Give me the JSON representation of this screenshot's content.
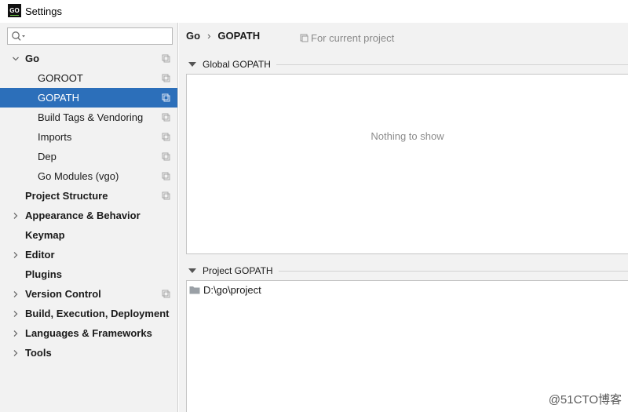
{
  "window": {
    "title": "Settings",
    "app_icon_text": "GO"
  },
  "search": {
    "value": "",
    "placeholder": ""
  },
  "sidebar": {
    "items": [
      {
        "label": "Go",
        "bold": true,
        "expanded": true,
        "has_arrow": true,
        "level": 0,
        "project_icon": true
      },
      {
        "label": "GOROOT",
        "bold": false,
        "has_arrow": false,
        "level": 1,
        "project_icon": true
      },
      {
        "label": "GOPATH",
        "bold": false,
        "has_arrow": false,
        "level": 1,
        "project_icon": true,
        "selected": true
      },
      {
        "label": "Build Tags & Vendoring",
        "bold": false,
        "has_arrow": false,
        "level": 1,
        "project_icon": true
      },
      {
        "label": "Imports",
        "bold": false,
        "has_arrow": false,
        "level": 1,
        "project_icon": true
      },
      {
        "label": "Dep",
        "bold": false,
        "has_arrow": false,
        "level": 1,
        "project_icon": true
      },
      {
        "label": "Go Modules (vgo)",
        "bold": false,
        "has_arrow": false,
        "level": 1,
        "project_icon": true
      },
      {
        "label": "Project Structure",
        "bold": true,
        "has_arrow": false,
        "level": 0,
        "project_icon": true
      },
      {
        "label": "Appearance & Behavior",
        "bold": true,
        "expanded": false,
        "has_arrow": true,
        "level": 0,
        "project_icon": false
      },
      {
        "label": "Keymap",
        "bold": true,
        "has_arrow": false,
        "level": 0,
        "project_icon": false
      },
      {
        "label": "Editor",
        "bold": true,
        "expanded": false,
        "has_arrow": true,
        "level": 0,
        "project_icon": false
      },
      {
        "label": "Plugins",
        "bold": true,
        "has_arrow": false,
        "level": 0,
        "project_icon": false
      },
      {
        "label": "Version Control",
        "bold": true,
        "expanded": false,
        "has_arrow": true,
        "level": 0,
        "project_icon": true
      },
      {
        "label": "Build, Execution, Deployment",
        "bold": true,
        "expanded": false,
        "has_arrow": true,
        "level": 0,
        "project_icon": false
      },
      {
        "label": "Languages & Frameworks",
        "bold": true,
        "expanded": false,
        "has_arrow": true,
        "level": 0,
        "project_icon": false
      },
      {
        "label": "Tools",
        "bold": true,
        "expanded": false,
        "has_arrow": true,
        "level": 0,
        "project_icon": false
      }
    ]
  },
  "main": {
    "breadcrumb": [
      "Go",
      "GOPATH"
    ],
    "breadcrumb_separator": "›",
    "scope_note": "For current project",
    "global_section": {
      "title": "Global GOPATH",
      "empty_text": "Nothing to show"
    },
    "project_section": {
      "title": "Project GOPATH",
      "paths": [
        "D:\\go\\project"
      ]
    }
  },
  "watermark": "@51CTO博客",
  "colors": {
    "selection": "#2c6fba",
    "sidebar_bg": "#f2f2f2",
    "panel_bg": "#ffffff",
    "muted_text": "#8c8c8c"
  }
}
